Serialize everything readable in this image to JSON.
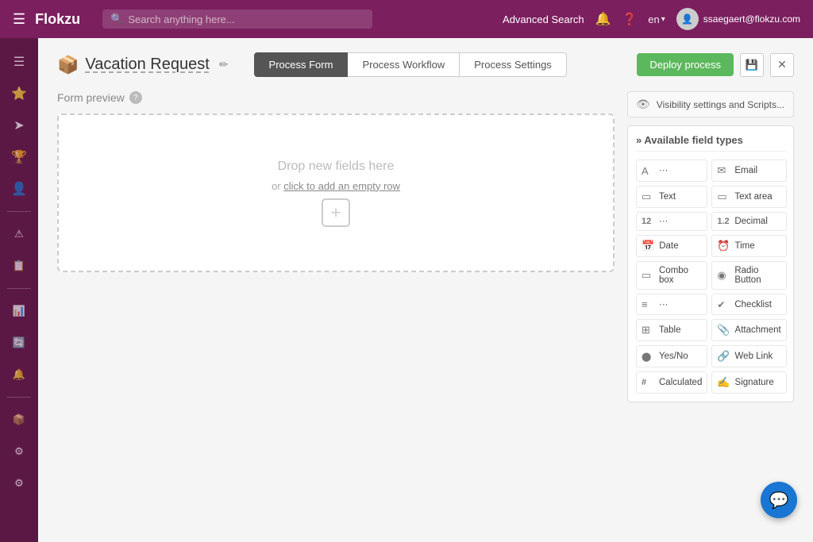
{
  "topnav": {
    "brand": "Flokzu",
    "menu_icon": "☰",
    "search_placeholder": "Search anything here...",
    "advanced_search": "Advanced Search",
    "bell_icon": "🔔",
    "help_icon": "?",
    "lang": "en",
    "user_email": "ssaegaert@flokzu.com"
  },
  "sidebar": {
    "items": [
      {
        "icon": "☰",
        "name": "menu"
      },
      {
        "icon": "⭐",
        "name": "favorites"
      },
      {
        "icon": "✉",
        "name": "messages"
      },
      {
        "icon": "🏆",
        "name": "achievements"
      },
      {
        "icon": "👤",
        "name": "profile"
      },
      {
        "icon": "⚠",
        "name": "alerts"
      },
      {
        "icon": "📋",
        "name": "tasks"
      },
      {
        "icon": "📊",
        "name": "reports"
      },
      {
        "icon": "🔄",
        "name": "integrations"
      },
      {
        "icon": "🔔",
        "name": "notifications"
      },
      {
        "icon": "📦",
        "name": "packages"
      },
      {
        "icon": "⚙",
        "name": "settings1"
      },
      {
        "icon": "⚙",
        "name": "settings2"
      }
    ]
  },
  "process": {
    "icon": "📦",
    "title": "Vacation Request",
    "edit_icon": "✏",
    "tabs": [
      {
        "label": "Process Form",
        "active": true
      },
      {
        "label": "Process Workflow",
        "active": false
      },
      {
        "label": "Process Settings",
        "active": false
      }
    ],
    "deploy_label": "Deploy process",
    "save_icon": "💾",
    "close_icon": "✕"
  },
  "form_preview": {
    "label": "Form preview",
    "help": "?",
    "drop_text": "Drop new fields here",
    "drop_link_text": "or",
    "drop_link_label": "click to add an empty row",
    "plus_icon": "+"
  },
  "right_panel": {
    "visibility_label": "Visibility settings and Scripts...",
    "eye_icon": "👁",
    "field_types_header": "» Available field types",
    "fields": [
      {
        "icon": "A",
        "label": ""
      },
      {
        "icon": "✉",
        "label": "Email"
      },
      {
        "icon": "▭",
        "label": "Text"
      },
      {
        "icon": "▭▭",
        "label": "Text area"
      },
      {
        "icon": "12",
        "label": ""
      },
      {
        "icon": "1.2",
        "label": "Decimal"
      },
      {
        "icon": "📅",
        "label": "Date"
      },
      {
        "icon": "⏰",
        "label": "Time"
      },
      {
        "icon": "▭",
        "label": "Combo box"
      },
      {
        "icon": "◉",
        "label": "Radio Button"
      },
      {
        "icon": "≡",
        "label": ""
      },
      {
        "icon": "✓",
        "label": "Checklist"
      },
      {
        "icon": "⊞",
        "label": "Table"
      },
      {
        "icon": "📎",
        "label": "Attachment"
      },
      {
        "icon": "◉",
        "label": "Yes/No"
      },
      {
        "icon": "🔗",
        "label": "Web Link"
      },
      {
        "icon": "#",
        "label": "Calculated"
      },
      {
        "icon": "✍",
        "label": "Signature"
      }
    ]
  },
  "fab": {
    "icon": "💬"
  }
}
